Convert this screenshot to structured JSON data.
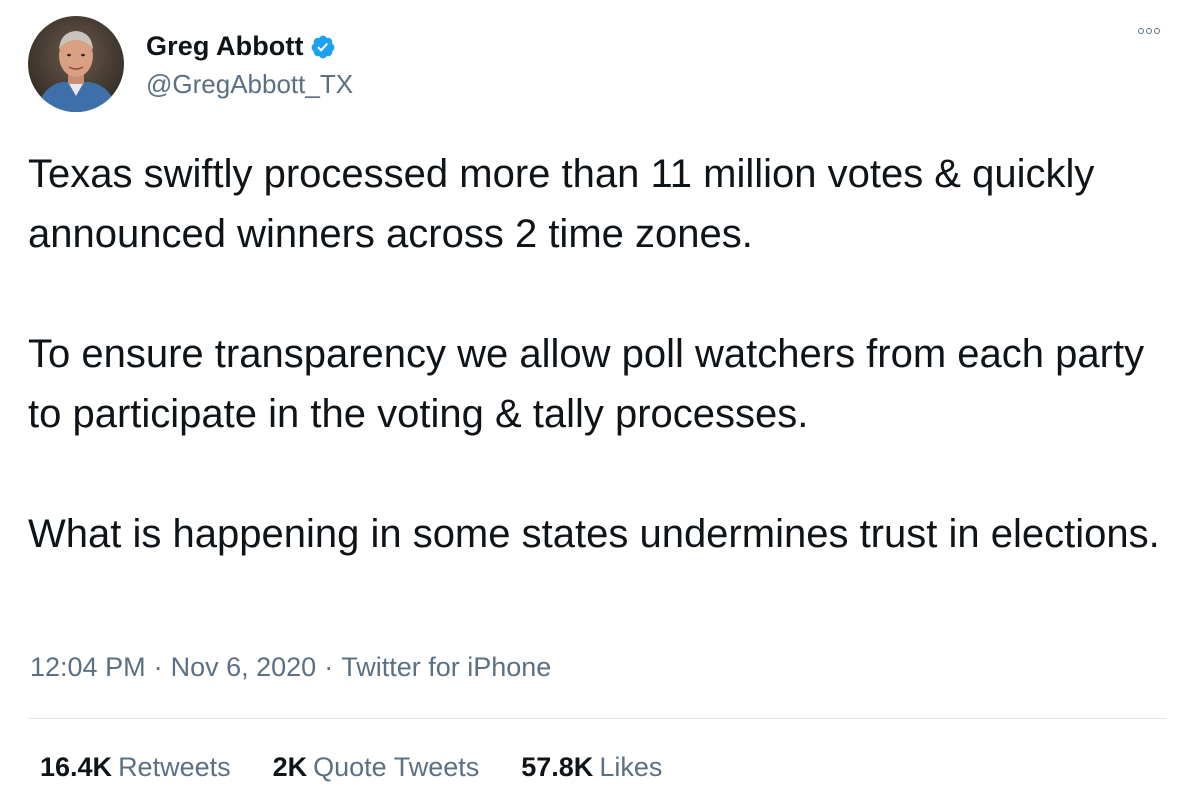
{
  "author": {
    "display_name": "Greg Abbott",
    "handle": "@GregAbbott_TX",
    "verified": true
  },
  "tweet": {
    "paragraphs": [
      "Texas swiftly processed more than 11 million votes & quickly announced winners across 2 time zones.",
      "To ensure transparency we allow poll watchers from each party to participate in the voting & tally processes.",
      "What is happening in some states undermines trust in elections."
    ],
    "time": "12:04 PM",
    "date": "Nov 6, 2020",
    "source": "Twitter for iPhone",
    "separator": "·"
  },
  "stats": {
    "retweets": {
      "count": "16.4K",
      "label": "Retweets"
    },
    "quotes": {
      "count": "2K",
      "label": "Quote Tweets"
    },
    "likes": {
      "count": "57.8K",
      "label": "Likes"
    }
  },
  "icons": {
    "verified": "verified-badge-icon",
    "more": "more-options-icon"
  },
  "colors": {
    "verified_blue": "#1da1f2",
    "secondary_text": "#5b7083",
    "primary_text": "#0f1419",
    "divider": "#e1e8ed"
  }
}
